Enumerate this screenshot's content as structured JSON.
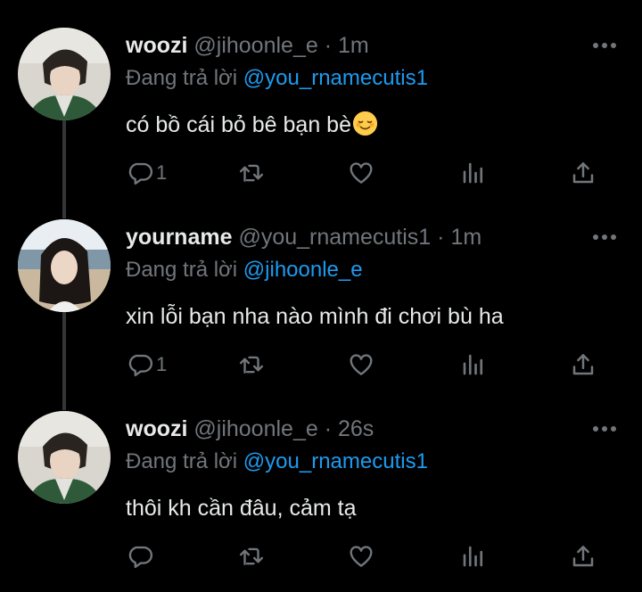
{
  "tweets": [
    {
      "name": "woozi",
      "handle": "@jihoonle_e",
      "dot": "·",
      "time": "1m",
      "reply_prefix": "Đang trả lời",
      "reply_to": "@you_rnamecutis1",
      "text": "có bồ cái bỏ bê bạn bè",
      "emoji": "relieved-face",
      "reply_count": "1"
    },
    {
      "name": "yourname",
      "handle": "@you_rnamecutis1",
      "dot": "·",
      "time": "1m",
      "reply_prefix": "Đang trả lời",
      "reply_to": "@jihoonle_e",
      "text": "xin lỗi bạn nha nào mình đi chơi bù ha",
      "reply_count": "1"
    },
    {
      "name": "woozi",
      "handle": "@jihoonle_e",
      "dot": "·",
      "time": "26s",
      "reply_prefix": "Đang trả lời",
      "reply_to": "@you_rnamecutis1",
      "text": "thôi kh cần đâu, cảm tạ",
      "reply_count": ""
    }
  ],
  "colors": {
    "background": "#000000",
    "text": "#e7e9ea",
    "secondary": "#71767b",
    "mention": "#1d9bf0",
    "thread_line": "#333639"
  }
}
